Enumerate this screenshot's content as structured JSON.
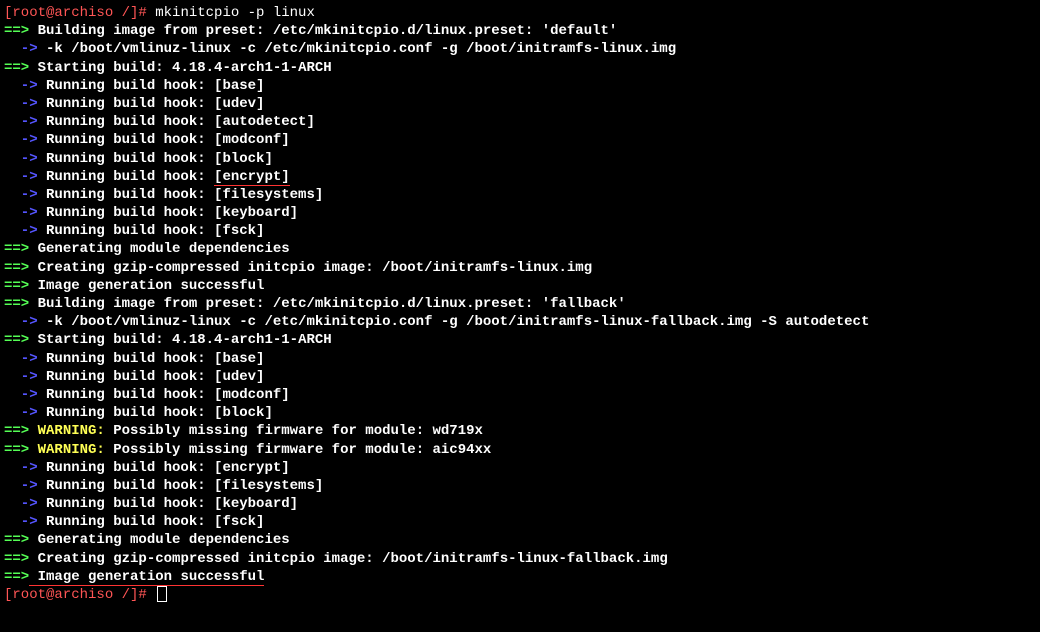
{
  "prompt1": "[root@archiso /]# ",
  "command": "mkinitcpio -p linux",
  "arrow": "==>",
  "subArrow": "  ->",
  "buildPreset1": " Building image from preset: /etc/mkinitcpio.d/linux.preset: 'default'",
  "kLine1": " -k /boot/vmlinuz-linux -c /etc/mkinitcpio.conf -g /boot/initramfs-linux.img",
  "startBuild": " Starting build: 4.18.4-arch1-1-ARCH",
  "hookBase": " Running build hook: ",
  "hookBaseVal": "[base]",
  "hookUdevVal": "[udev]",
  "hookAutodetectVal": "[autodetect]",
  "hookModconfVal": "[modconf]",
  "hookBlockVal": "[block]",
  "hookEncryptVal": "[encrypt]",
  "hookFilesystemsVal": "[filesystems]",
  "hookKeyboardVal": "[keyboard]",
  "hookFsckVal": "[fsck]",
  "genModDeps": " Generating module dependencies",
  "creatingGzip1": " Creating gzip-compressed initcpio image: ",
  "imgPath1": "/boot/initramfs-linux.img",
  "imageSuccess": " Image generation successful",
  "buildPreset2": " Building image from preset: /etc/mkinitcpio.d/linux.preset: 'fallback'",
  "kLine2": " -k /boot/vmlinuz-linux -c /etc/mkinitcpio.conf -g /boot/initramfs-linux-fallback.img -S autodetect",
  "warningLabel": "WARNING:",
  "warning1": " Possibly missing firmware for module: wd719x",
  "warning2": " Possibly missing firmware for module: aic94xx",
  "creatingGzip2": " Creating gzip-compressed initcpio image: ",
  "imgPath2": "/boot/initramfs-linux-fallback.img",
  "prompt2": "[root@archiso /]# "
}
